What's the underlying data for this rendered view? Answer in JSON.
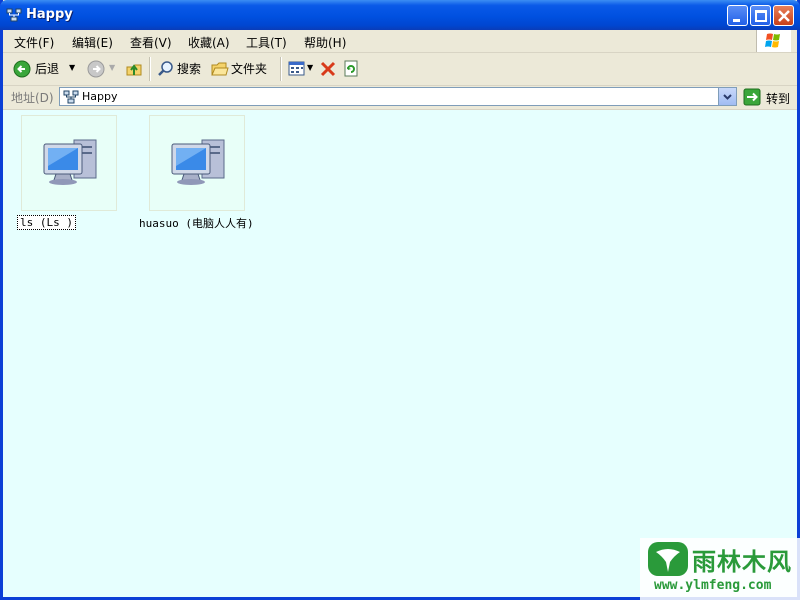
{
  "window": {
    "title": "Happy"
  },
  "menu": [
    "文件(F)",
    "编辑(E)",
    "查看(V)",
    "收藏(A)",
    "工具(T)",
    "帮助(H)"
  ],
  "toolbar": {
    "back": "后退",
    "search": "搜索",
    "folders": "文件夹"
  },
  "address": {
    "label": "地址(D)",
    "value": "Happy",
    "go": "转到"
  },
  "items": [
    {
      "label": "ls        (Ls    )",
      "selected": true
    },
    {
      "label": "huasuo (电脑人人有)",
      "selected": false
    }
  ],
  "watermark": {
    "brand": "雨林木风",
    "url": "www.ylmfeng.com"
  }
}
